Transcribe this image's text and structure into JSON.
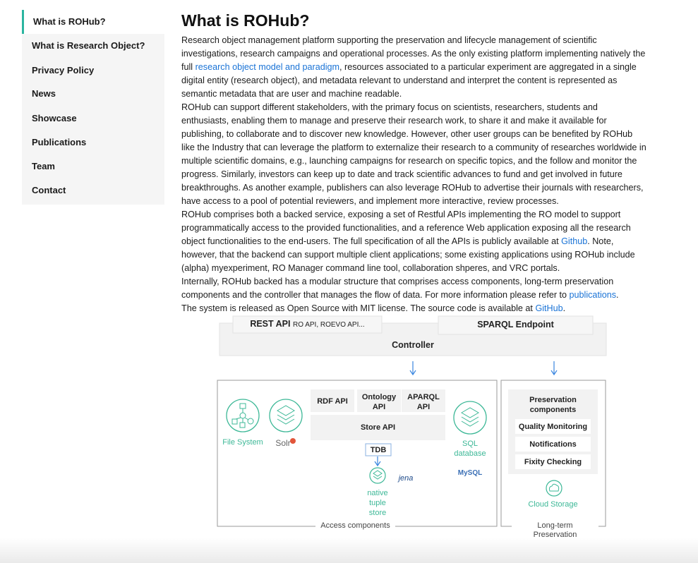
{
  "sidebar": {
    "items": [
      {
        "label": "What is ROHub?",
        "active": true
      },
      {
        "label": "What is Research Object?"
      },
      {
        "label": "Privacy Policy"
      },
      {
        "label": "News"
      },
      {
        "label": "Showcase"
      },
      {
        "label": "Publications"
      },
      {
        "label": "Team"
      },
      {
        "label": "Contact"
      }
    ]
  },
  "main": {
    "title": "What is ROHub?",
    "p1": {
      "a": "Research object management platform supporting the preservation and lifecycle management of scientific investigations, research campaigns and operational processes. As the only existing platform implementing natively the full ",
      "link": "research object model and paradigm",
      "b": ", resources associated to a particular experiment are aggregated in a single digital entity (research object), and metadata relevant to understand and interpret the content is represented as semantic metadata that are user and machine readable."
    },
    "p2": "ROHub can support different stakeholders, with the primary focus on scientists, researchers, students and enthusiasts, enabling them to manage and preserve their research work, to share it and make it available for publishing, to collaborate and to discover new knowledge. However, other user groups can be benefited by ROHub like the Industry that can leverage the platform to externalize their research to a community of researches worldwide in multiple scientific domains, e.g., launching campaigns for research on specific topics, and the follow and monitor the progress. Similarly, investors can keep up to date and track scientific advances to fund and get involved in future breakthroughs. As another example, publishers can also leverage ROHub to advertise their journals with researchers, have access to a pool of potential reviewers, and implement more interactive, review processes.",
    "p3": {
      "a": "ROHub comprises both a backed service, exposing a set of Restful APIs implementing the RO model to support programmatically access to the provided functionalities, and a reference Web application exposing all the research object functionalities to the end-users. The full specification of all the APIs is publicly available at ",
      "link": "Github",
      "b": ". Note, however, that the backend can support multiple client applications; some existing applications using ROHub include (alpha) myexperiment, RO Manager command line tool, collaboration shperes, and VRC portals."
    },
    "p4": {
      "a": "Internally, ROHub backed has a modular structure that comprises access components, long-term preservation components and the controller that manages the flow of data. For more information please refer to ",
      "link": "publications",
      "b": "."
    },
    "p5": {
      "a": "The system is released as Open Source with MIT license. The source code is available at ",
      "link": "GitHub",
      "b": "."
    }
  },
  "diagram": {
    "rest_api": "REST API",
    "rest_api_sub": "RO API, ROEVO API...",
    "sparql": "SPARQL Endpoint",
    "controller": "Controller",
    "rdf_api": "RDF API",
    "ontology_api": "Ontology API",
    "aparql_api": "APARQL API",
    "store_api": "Store API",
    "tdb": "TDB",
    "file_system": "File System",
    "solr": "Solr",
    "sql_db": "SQL database",
    "mysql": "MySQL",
    "native_store": "native tuple store",
    "jena": "jena",
    "preservation": "Preservation components",
    "quality": "Quality Monitoring",
    "notifications": "Notifications",
    "fixity": "Fixity Checking",
    "cloud": "Cloud Storage",
    "access_label": "Access components",
    "ltp_label": "Long-term Preservation components"
  },
  "colors": {
    "accent": "#2bb5a0",
    "link": "#1a73d6",
    "teal_icon": "#3db897",
    "arrow": "#3a86e0"
  }
}
